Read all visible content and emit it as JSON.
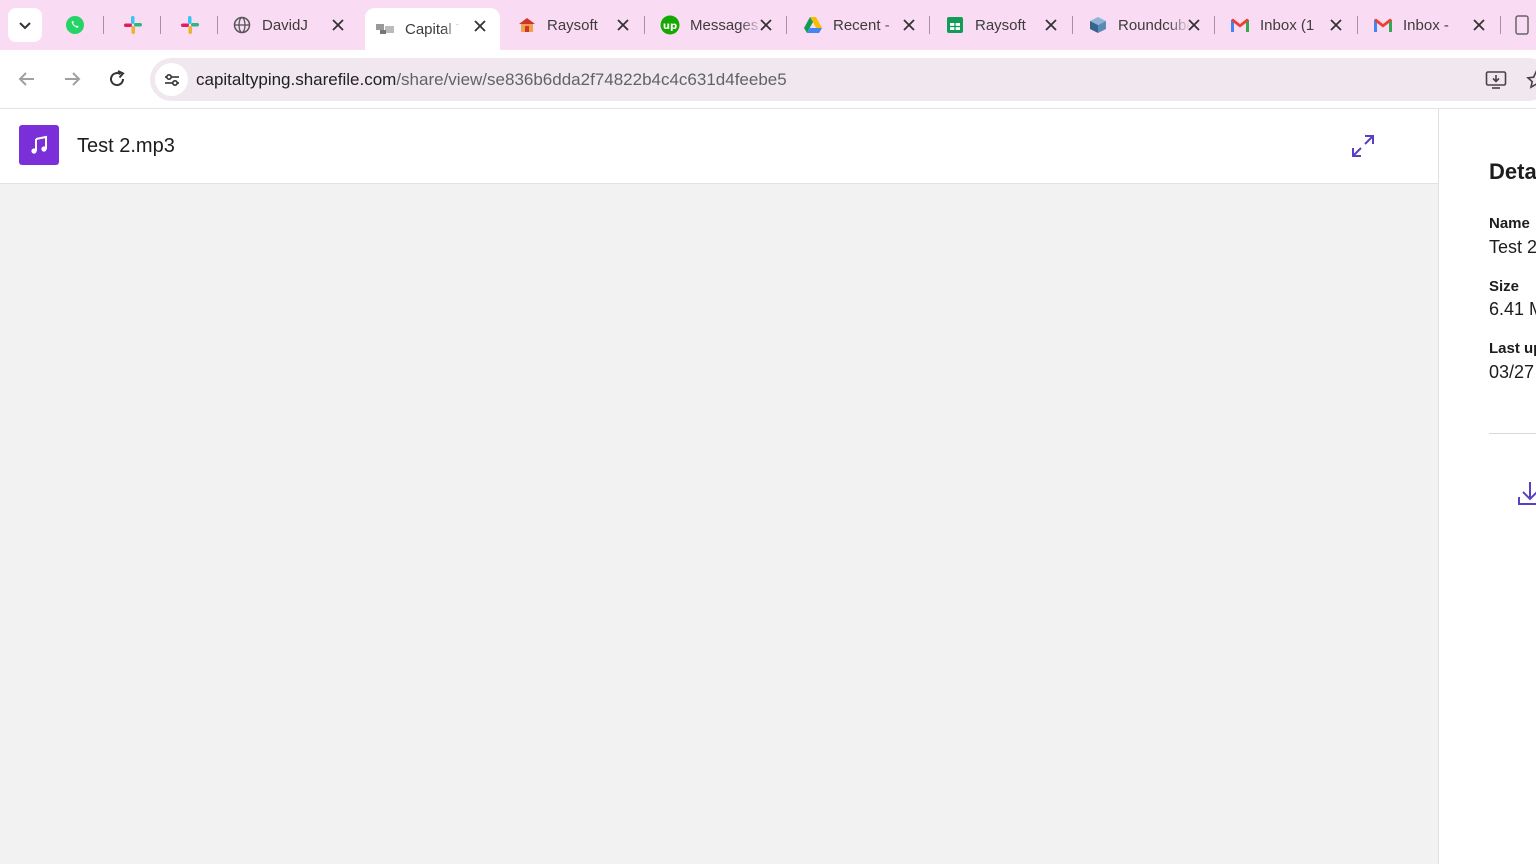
{
  "browser": {
    "tabs": [
      {
        "title": "DavidJ",
        "icon": "globe-icon"
      },
      {
        "title": "Capital T",
        "icon": "sharefile-icon",
        "active": true
      },
      {
        "title": "Raysoft",
        "icon": "raysoft-icon"
      },
      {
        "title": "Messages",
        "icon": "upwork-icon"
      },
      {
        "title": "Recent -",
        "icon": "google-drive-icon"
      },
      {
        "title": "Raysoft",
        "icon": "google-sheets-icon"
      },
      {
        "title": "Roundcube",
        "icon": "roundcube-icon"
      },
      {
        "title": "Inbox (1",
        "icon": "gmail-icon"
      },
      {
        "title": "Inbox -",
        "icon": "gmail-icon"
      }
    ],
    "pinned": [
      "whatsapp-icon",
      "slack-icon",
      "slack-icon"
    ],
    "url_host": "capitaltyping.sharefile.com",
    "url_path": "/share/view/se836b6dda2f74822b4c4c631d4feebe5"
  },
  "viewer": {
    "file_name": "Test 2.mp3",
    "file_icon": "music-note-icon"
  },
  "details": {
    "heading": "Deta",
    "name_label": "Name",
    "name_value": "Test 2",
    "size_label": "Size",
    "size_value": "6.41 M",
    "uploaded_label": "Last up",
    "uploaded_value": "03/27"
  },
  "colors": {
    "tabstrip": "#f9dcf3",
    "accent_purple": "#7b2fd9",
    "viewer_bg": "#f2f2f2"
  }
}
